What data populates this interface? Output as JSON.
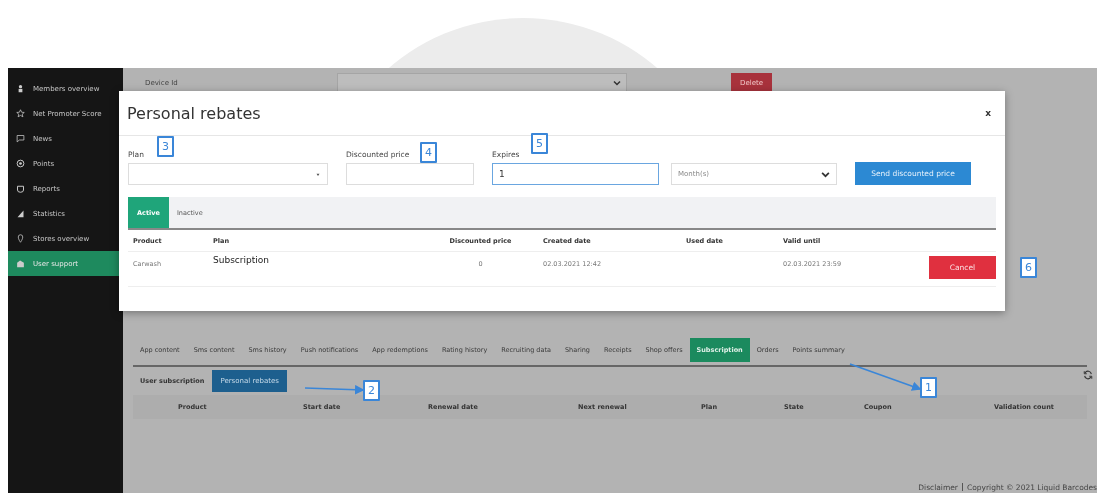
{
  "sidebar": {
    "items": [
      {
        "label": "Members overview",
        "selected": false
      },
      {
        "label": "Net Promoter Score",
        "selected": false
      },
      {
        "label": "News",
        "selected": false
      },
      {
        "label": "Points",
        "selected": false
      },
      {
        "label": "Reports",
        "selected": false
      },
      {
        "label": "Statistics",
        "selected": false
      },
      {
        "label": "Stores overview",
        "selected": false
      },
      {
        "label": "User support",
        "selected": true
      }
    ]
  },
  "device": {
    "label": "Device Id",
    "delete_button": "Delete"
  },
  "tabs": [
    {
      "label": "App content",
      "selected": false
    },
    {
      "label": "Sms content",
      "selected": false
    },
    {
      "label": "Sms history",
      "selected": false
    },
    {
      "label": "Push notifications",
      "selected": false
    },
    {
      "label": "App redemptions",
      "selected": false
    },
    {
      "label": "Rating history",
      "selected": false
    },
    {
      "label": "Recruiting data",
      "selected": false
    },
    {
      "label": "Sharing",
      "selected": false
    },
    {
      "label": "Receipts",
      "selected": false
    },
    {
      "label": "Shop offers",
      "selected": false
    },
    {
      "label": "Subscription",
      "selected": true
    },
    {
      "label": "Orders",
      "selected": false
    },
    {
      "label": "Points summary",
      "selected": false
    }
  ],
  "subscription_bar": {
    "label": "User subscription",
    "button": "Personal rebates"
  },
  "table": {
    "columns": [
      "Product",
      "Start date",
      "Renewal date",
      "Next renewal",
      "Plan",
      "State",
      "Coupon",
      "Validation count"
    ]
  },
  "footer": {
    "links": [
      "Disclaimer",
      "Copyright © 2021 Liquid Barcodes"
    ]
  },
  "modal": {
    "title": "Personal rebates",
    "close": "x",
    "fields": [
      {
        "kind": "select",
        "label": "Plan",
        "focused": false
      },
      {
        "kind": "text",
        "label": "Discounted price",
        "focused": false
      },
      {
        "kind": "text",
        "label": "Expires",
        "value": "1",
        "focused": true
      },
      {
        "kind": "select",
        "value": "Month(s)",
        "focused": false
      }
    ],
    "send_button": "Send discounted price",
    "tabs": [
      {
        "label": "Active",
        "selected": true
      },
      {
        "label": "Inactive",
        "selected": false
      }
    ],
    "table": {
      "columns": [
        "Product",
        "Plan",
        "Discounted price",
        "Created date",
        "Used date",
        "Valid until"
      ],
      "rows": [
        {
          "product": "Carwash",
          "plan": "Subscription",
          "discounted_price": "0",
          "created_date": "02.03.2021 12:42",
          "valid_until": "02.03.2021 23:59",
          "action": "Cancel"
        }
      ]
    }
  },
  "annotations": [
    {
      "label": "1"
    },
    {
      "label": "2"
    },
    {
      "label": "3"
    },
    {
      "label": "4"
    },
    {
      "label": "5"
    },
    {
      "label": "6"
    }
  ]
}
